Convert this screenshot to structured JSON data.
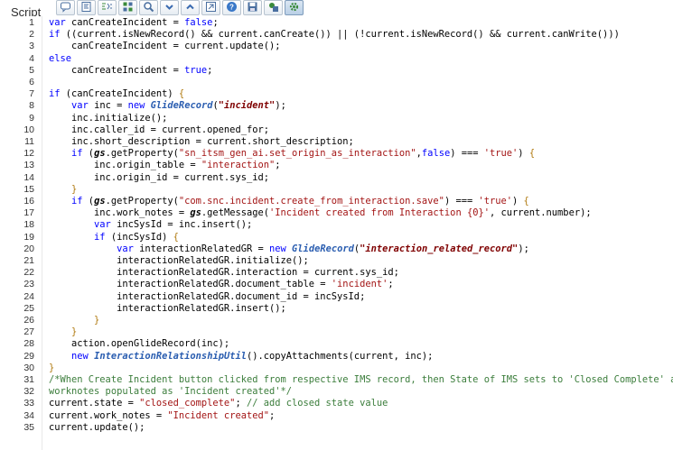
{
  "field_label": "Script",
  "toolbar": {
    "buttons": [
      {
        "name": "comment-icon"
      },
      {
        "name": "format-icon"
      },
      {
        "name": "toggle-comment-icon"
      },
      {
        "name": "toggle-full-screen-icon"
      },
      {
        "name": "search-icon"
      },
      {
        "name": "chevron-down-icon"
      },
      {
        "name": "chevron-up-icon"
      },
      {
        "name": "goto-line-icon"
      },
      {
        "name": "help-icon"
      },
      {
        "name": "save-icon"
      },
      {
        "name": "script-debugger-icon"
      },
      {
        "name": "settings-icon"
      }
    ]
  },
  "code_lines": [
    {
      "n": "1",
      "tokens": [
        [
          "kw",
          "var"
        ],
        [
          "t",
          " canCreateIncident = "
        ],
        [
          "kw",
          "false"
        ],
        [
          "t",
          ";"
        ]
      ]
    },
    {
      "n": "2",
      "tokens": [
        [
          "kw",
          "if"
        ],
        [
          "t",
          " ((current.isNewRecord() && current.canCreate()) || (!current.isNewRecord() && current.canWrite()))"
        ]
      ]
    },
    {
      "n": "3",
      "tokens": [
        [
          "t",
          "    canCreateIncident = current.update();"
        ]
      ]
    },
    {
      "n": "4",
      "tokens": [
        [
          "kw",
          "else"
        ]
      ]
    },
    {
      "n": "5",
      "tokens": [
        [
          "t",
          "    canCreateIncident = "
        ],
        [
          "kw",
          "true"
        ],
        [
          "t",
          ";"
        ]
      ]
    },
    {
      "n": "6",
      "tokens": []
    },
    {
      "n": "7",
      "tokens": [
        [
          "kw",
          "if"
        ],
        [
          "t",
          " (canCreateIncident) "
        ],
        [
          "brace",
          "{"
        ]
      ]
    },
    {
      "n": "8",
      "tokens": [
        [
          "t",
          "    "
        ],
        [
          "kw",
          "var"
        ],
        [
          "t",
          " inc = "
        ],
        [
          "kw",
          "new"
        ],
        [
          "t",
          " "
        ],
        [
          "cls",
          "GlideRecord"
        ],
        [
          "t",
          "("
        ],
        [
          "strb",
          "\"incident\""
        ],
        [
          "t",
          ");"
        ]
      ]
    },
    {
      "n": "9",
      "tokens": [
        [
          "t",
          "    inc.initialize();"
        ]
      ]
    },
    {
      "n": "10",
      "tokens": [
        [
          "t",
          "    inc.caller_id = current.opened_for;"
        ]
      ]
    },
    {
      "n": "11",
      "tokens": [
        [
          "t",
          "    inc.short_description = current.short_description;"
        ]
      ]
    },
    {
      "n": "12",
      "tokens": [
        [
          "t",
          "    "
        ],
        [
          "kw",
          "if"
        ],
        [
          "t",
          " ("
        ],
        [
          "gs",
          "gs"
        ],
        [
          "t",
          ".getProperty("
        ],
        [
          "str",
          "\"sn_itsm_gen_ai.set_origin_as_interaction\""
        ],
        [
          "t",
          ","
        ],
        [
          "kw",
          "false"
        ],
        [
          "t",
          ") === "
        ],
        [
          "str",
          "'true'"
        ],
        [
          "t",
          ") "
        ],
        [
          "brace",
          "{"
        ]
      ]
    },
    {
      "n": "13",
      "tokens": [
        [
          "t",
          "        inc.origin_table = "
        ],
        [
          "str",
          "\"interaction\""
        ],
        [
          "t",
          ";"
        ]
      ]
    },
    {
      "n": "14",
      "tokens": [
        [
          "t",
          "        inc.origin_id = current.sys_id;"
        ]
      ]
    },
    {
      "n": "15",
      "tokens": [
        [
          "t",
          "    "
        ],
        [
          "brace",
          "}"
        ]
      ]
    },
    {
      "n": "16",
      "tokens": [
        [
          "t",
          "    "
        ],
        [
          "kw",
          "if"
        ],
        [
          "t",
          " ("
        ],
        [
          "gs",
          "gs"
        ],
        [
          "t",
          ".getProperty("
        ],
        [
          "str",
          "\"com.snc.incident.create_from_interaction.save\""
        ],
        [
          "t",
          ") === "
        ],
        [
          "str",
          "'true'"
        ],
        [
          "t",
          ") "
        ],
        [
          "brace",
          "{"
        ]
      ]
    },
    {
      "n": "17",
      "tokens": [
        [
          "t",
          "        inc.work_notes = "
        ],
        [
          "gs",
          "gs"
        ],
        [
          "t",
          ".getMessage("
        ],
        [
          "str",
          "'Incident created from Interaction {0}'"
        ],
        [
          "t",
          ", current.number);"
        ]
      ]
    },
    {
      "n": "18",
      "tokens": [
        [
          "t",
          "        "
        ],
        [
          "kw",
          "var"
        ],
        [
          "t",
          " incSysId = inc.insert();"
        ]
      ]
    },
    {
      "n": "19",
      "tokens": [
        [
          "t",
          "        "
        ],
        [
          "kw",
          "if"
        ],
        [
          "t",
          " (incSysId) "
        ],
        [
          "brace",
          "{"
        ]
      ]
    },
    {
      "n": "20",
      "tokens": [
        [
          "t",
          "            "
        ],
        [
          "kw",
          "var"
        ],
        [
          "t",
          " interactionRelatedGR = "
        ],
        [
          "kw",
          "new"
        ],
        [
          "t",
          " "
        ],
        [
          "cls",
          "GlideRecord"
        ],
        [
          "t",
          "("
        ],
        [
          "strb",
          "\"interaction_related_record\""
        ],
        [
          "t",
          ");"
        ]
      ]
    },
    {
      "n": "21",
      "tokens": [
        [
          "t",
          "            interactionRelatedGR.initialize();"
        ]
      ]
    },
    {
      "n": "22",
      "tokens": [
        [
          "t",
          "            interactionRelatedGR.interaction = current.sys_id;"
        ]
      ]
    },
    {
      "n": "23",
      "tokens": [
        [
          "t",
          "            interactionRelatedGR.document_table = "
        ],
        [
          "str",
          "'incident'"
        ],
        [
          "t",
          ";"
        ]
      ]
    },
    {
      "n": "24",
      "tokens": [
        [
          "t",
          "            interactionRelatedGR.document_id = incSysId;"
        ]
      ]
    },
    {
      "n": "25",
      "tokens": [
        [
          "t",
          "            interactionRelatedGR.insert();"
        ]
      ]
    },
    {
      "n": "26",
      "tokens": [
        [
          "t",
          "        "
        ],
        [
          "brace",
          "}"
        ]
      ]
    },
    {
      "n": "27",
      "tokens": [
        [
          "t",
          "    "
        ],
        [
          "brace",
          "}"
        ]
      ]
    },
    {
      "n": "28",
      "tokens": [
        [
          "t",
          "    action.openGlideRecord(inc);"
        ]
      ]
    },
    {
      "n": "29",
      "tokens": [
        [
          "t",
          "    "
        ],
        [
          "kw",
          "new"
        ],
        [
          "t",
          " "
        ],
        [
          "cls",
          "InteractionRelationshipUtil"
        ],
        [
          "t",
          "().copyAttachments(current, inc);"
        ]
      ]
    },
    {
      "n": "30",
      "tokens": [
        [
          "brace",
          "}"
        ]
      ]
    },
    {
      "n": "31",
      "tokens": [
        [
          "cm",
          "/*When Create Incident button clicked from respective IMS record, then State of IMS sets to 'Closed Complete' and"
        ]
      ]
    },
    {
      "n": "32",
      "tokens": [
        [
          "cm",
          "worknotes populated as 'Incident created'*/"
        ]
      ]
    },
    {
      "n": "33",
      "tokens": [
        [
          "t",
          "current.state = "
        ],
        [
          "str",
          "\"closed_complete\""
        ],
        [
          "t",
          "; "
        ],
        [
          "cm",
          "// add closed state value"
        ]
      ]
    },
    {
      "n": "34",
      "tokens": [
        [
          "t",
          "current.work_notes = "
        ],
        [
          "str",
          "\"Incident created\""
        ],
        [
          "t",
          ";"
        ]
      ]
    },
    {
      "n": "35",
      "tokens": [
        [
          "t",
          "current.update();"
        ]
      ]
    }
  ]
}
